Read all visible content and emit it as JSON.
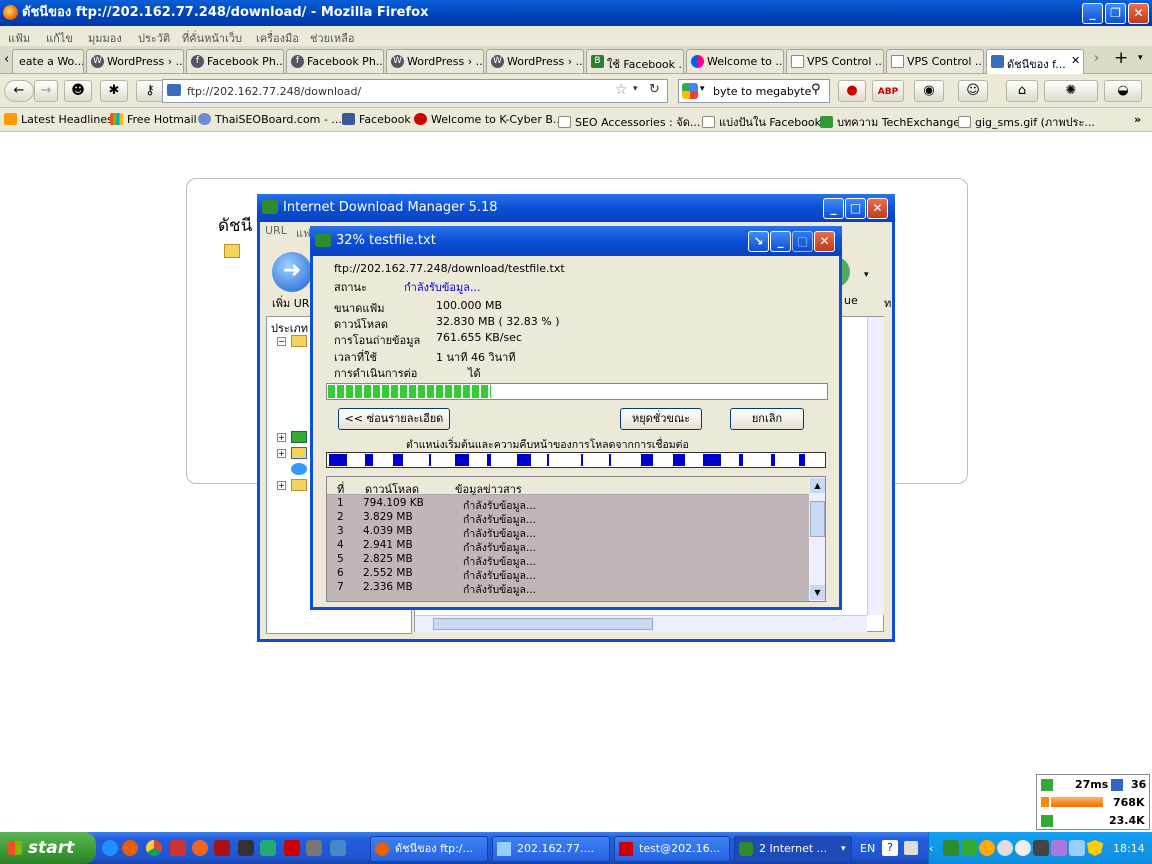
{
  "window": {
    "title": "ดัชนีของ ftp://202.162.77.248/download/ - Mozilla Firefox"
  },
  "menubar": [
    "แฟ้ม",
    "แก้ไข",
    "มุมมอง",
    "ประวัติ",
    "ที่คั่นหน้าเว็บ",
    "เครื่องมือ",
    "ช่วยเหลือ"
  ],
  "tabs": [
    {
      "label": "eate a Wo..."
    },
    {
      "label": "WordPress › ..."
    },
    {
      "label": "Facebook Ph..."
    },
    {
      "label": "Facebook Ph..."
    },
    {
      "label": "WordPress › ..."
    },
    {
      "label": "WordPress › ..."
    },
    {
      "label": "ใช้ Facebook ..."
    },
    {
      "label": "Welcome to ..."
    },
    {
      "label": "VPS Control ..."
    },
    {
      "label": "VPS Control ..."
    },
    {
      "label": "ดัชนีของ f..."
    }
  ],
  "nav": {
    "url": "ftp://202.162.77.248/download/",
    "search": "byte to megabyte"
  },
  "bookmarks": [
    "Latest Headlines",
    "Free Hotmail",
    "ThaiSEOBoard.com - ...",
    "Facebook",
    "Welcome to K-Cyber B...",
    "SEO Accessories : จัด...",
    "แบ่งปันใน Facebook",
    "บทความ TechExchange",
    "gig_sms.gif (ภาพประ..."
  ],
  "page": {
    "heading": "ดัชนี"
  },
  "idm": {
    "title": "Internet Download Manager 5.18",
    "menu": "URL",
    "menu_more": "แฟ",
    "add_url": "เพิ่ม URL",
    "category": "ประเภท",
    "side_label": "ue",
    "side_label2": "ท"
  },
  "dialog": {
    "title": "32% testfile.txt",
    "url": "ftp://202.162.77.248/download/testfile.txt",
    "status_label": "สถานะ",
    "status_value": "กำลังรับข้อมูล...",
    "size_label": "ขนาดแฟ้ม",
    "size_value": "100.000  MB",
    "downloaded_label": "ดาวน์โหลด",
    "downloaded_value": "32.830  MB  ( 32.83 % )",
    "rate_label": "การโอนถ่ายข้อมูล",
    "rate_value": "761.655  KB/sec",
    "time_label": "เวลาที่ใช้",
    "time_value": "1 นาที 46 วินาที",
    "resume_label": "การดำเนินการต่อ",
    "resume_value": "ได้",
    "progress": 0.3283,
    "btn_details": "<< ซ่อนรายละเอียด",
    "btn_pause": "หยุดชั่วขณะ",
    "btn_cancel": "ยกเลิก",
    "seg_caption": "ตำแหน่งเริ่มต้นและความคืบหน้าของการโหลดจากการเชื่อมต่อ",
    "col_no": "ที่",
    "col_dl": "ดาวน์โหลด",
    "col_info": "ข้อมูลข่าวสาร",
    "connections": [
      {
        "n": "1",
        "dl": "794.109  KB",
        "info": "กำลังรับข้อมูล..."
      },
      {
        "n": "2",
        "dl": "3.829  MB",
        "info": "กำลังรับข้อมูล..."
      },
      {
        "n": "3",
        "dl": "4.039  MB",
        "info": "กำลังรับข้อมูล..."
      },
      {
        "n": "4",
        "dl": "2.941  MB",
        "info": "กำลังรับข้อมูล..."
      },
      {
        "n": "5",
        "dl": "2.825  MB",
        "info": "กำลังรับข้อมูล..."
      },
      {
        "n": "6",
        "dl": "2.552  MB",
        "info": "กำลังรับข้อมูล..."
      },
      {
        "n": "7",
        "dl": "2.336  MB",
        "info": "กำลังรับข้อมูล..."
      }
    ]
  },
  "tray_popup": {
    "ping": "27ms",
    "count": "36",
    "down": "768K",
    "up": "23.4K"
  },
  "taskbar": {
    "start": "start",
    "tasks": [
      "ดัชนีของ ftp:/...",
      "202.162.77....",
      "test@202.16...",
      "2 Internet ..."
    ],
    "lang": "EN",
    "clock": "18:14"
  }
}
